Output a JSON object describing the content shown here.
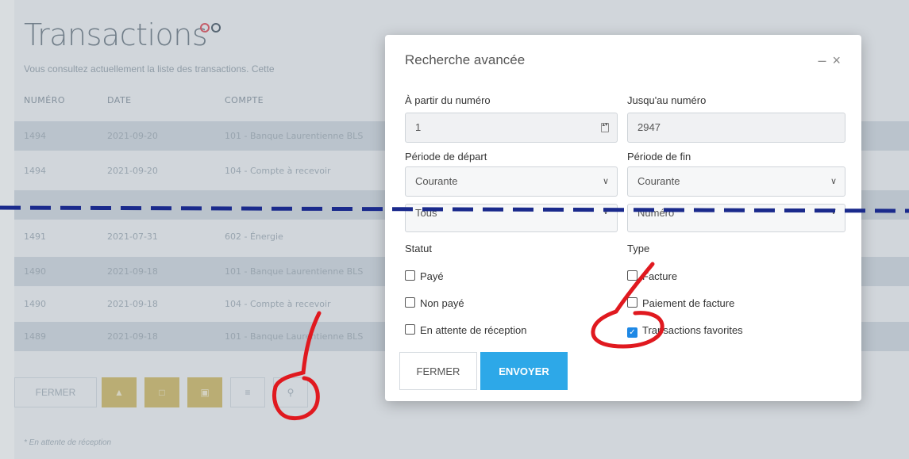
{
  "page": {
    "title": "Transactions",
    "description": "Vous consultez actuellement la liste des transactions. Cette",
    "footnote": "* En attente de réception"
  },
  "table": {
    "headers": [
      "NUMÉRO",
      "DATE",
      "COMPTE"
    ],
    "rows": [
      {
        "num": "1494",
        "date": "2021-09-20",
        "compte": "101 - Banque Laurentienne BLS"
      },
      {
        "num": "1494",
        "date": "2021-09-20",
        "compte": "104 - Compte à recevoir"
      },
      {
        "num": "",
        "date": "",
        "compte": ""
      },
      {
        "num": "1491",
        "date": "2021-07-31",
        "compte": "602 - Énergie"
      },
      {
        "num": "1490",
        "date": "2021-09-18",
        "compte": "101 - Banque Laurentienne BLS"
      },
      {
        "num": "1490",
        "date": "2021-09-18",
        "compte": "104 - Compte à recevoir"
      },
      {
        "num": "1489",
        "date": "2021-09-18",
        "compte": "101 - Banque Laurentienne BLS"
      }
    ]
  },
  "footer": {
    "close_label": "FERMER",
    "icons": [
      "upload-icon",
      "document-icon",
      "document-export-icon",
      "list-icon",
      "search-icon"
    ]
  },
  "modal": {
    "title": "Recherche avancée",
    "from_number_label": "À partir du numéro",
    "from_number_value": "1",
    "to_number_label": "Jusqu'au numéro",
    "to_number_value": "2947",
    "start_period_label": "Période de départ",
    "start_period_value": "Courante",
    "end_period_label": "Période de fin",
    "end_period_value": "Courante",
    "filter_a_value": "Tous",
    "filter_b_value": "Numéro",
    "statut_label": "Statut",
    "type_label": "Type",
    "statut_options": [
      {
        "label": "Payé",
        "checked": false
      },
      {
        "label": "Non payé",
        "checked": false
      },
      {
        "label": "En attente de réception",
        "checked": false
      }
    ],
    "type_options": [
      {
        "label": "Facture",
        "checked": false
      },
      {
        "label": "Paiement de facture",
        "checked": false
      },
      {
        "label": "Transactions favorites",
        "checked": true
      }
    ],
    "close_button": "FERMER",
    "send_button": "ENVOYER"
  },
  "colors": {
    "accent": "#2da8e8",
    "annotation_red": "#e0191f",
    "annotation_blue": "#1a2a8c",
    "footer_yellow": "#d4bd6a"
  }
}
